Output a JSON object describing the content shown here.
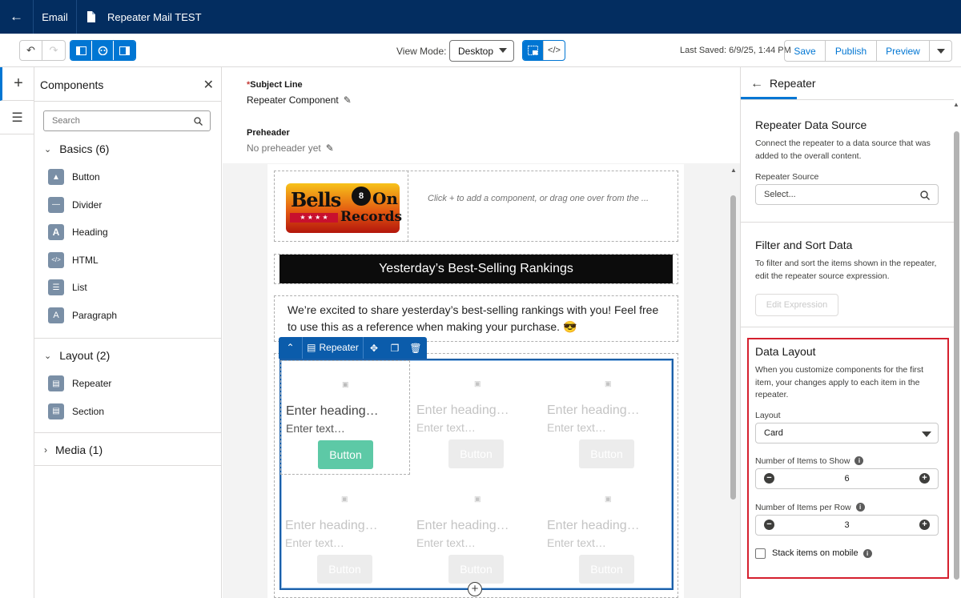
{
  "topbar": {
    "email_label": "Email",
    "doc_title": "Repeater Mail TEST"
  },
  "toolbar": {
    "view_mode_label": "View Mode:",
    "view_mode_value": "Desktop",
    "last_saved": "Last Saved: 6/9/25, 1:44 PM",
    "save": "Save",
    "publish": "Publish",
    "preview": "Preview"
  },
  "components": {
    "title": "Components",
    "search_placeholder": "Search",
    "basics": {
      "label": "Basics (6)",
      "items": [
        "Button",
        "Divider",
        "Heading",
        "HTML",
        "List",
        "Paragraph"
      ]
    },
    "layout": {
      "label": "Layout (2)",
      "items": [
        "Repeater",
        "Section"
      ]
    },
    "media": {
      "label": "Media (1)"
    }
  },
  "email": {
    "subject_label": "Subject Line",
    "subject_value": "Repeater Component",
    "preheader_label": "Preheader",
    "preheader_value": "No preheader yet",
    "logo_top": "Bells",
    "logo_on": "On",
    "logo_bottom": "Records",
    "drop_hint": "Click + to add a component, or drag one over from the ...",
    "banner": "Yesterday’s Best-Selling Rankings",
    "intro": "We’re excited to share yesterday’s best-selling rankings with you! Feel free to use this as a reference when making your purchase. 😎",
    "repeater_tag": "Repeater",
    "card_heading": "Enter heading…",
    "card_text": "Enter text…",
    "card_button": "Button"
  },
  "panel": {
    "title": "Repeater",
    "ds_title": "Repeater Data Source",
    "ds_desc": "Connect the repeater to a data source that was added to the overall content.",
    "source_label": "Repeater Source",
    "source_placeholder": "Select...",
    "fs_title": "Filter and Sort Data",
    "fs_desc": "To filter and sort the items shown in the repeater, edit the repeater source expression.",
    "edit_expression": "Edit Expression",
    "dl_title": "Data Layout",
    "dl_desc": "When you customize components for the first item, your changes apply to each item in the repeater.",
    "layout_label": "Layout",
    "layout_value": "Card",
    "items_show_label": "Number of Items to Show",
    "items_show_value": "6",
    "items_row_label": "Number of Items per Row",
    "items_row_value": "3",
    "stack_label": "Stack items on mobile"
  },
  "colors": {
    "brand_dark": "#032d60",
    "accent": "#0176d3",
    "highlight": "#c23934",
    "button_green": "#5dc9a6"
  }
}
